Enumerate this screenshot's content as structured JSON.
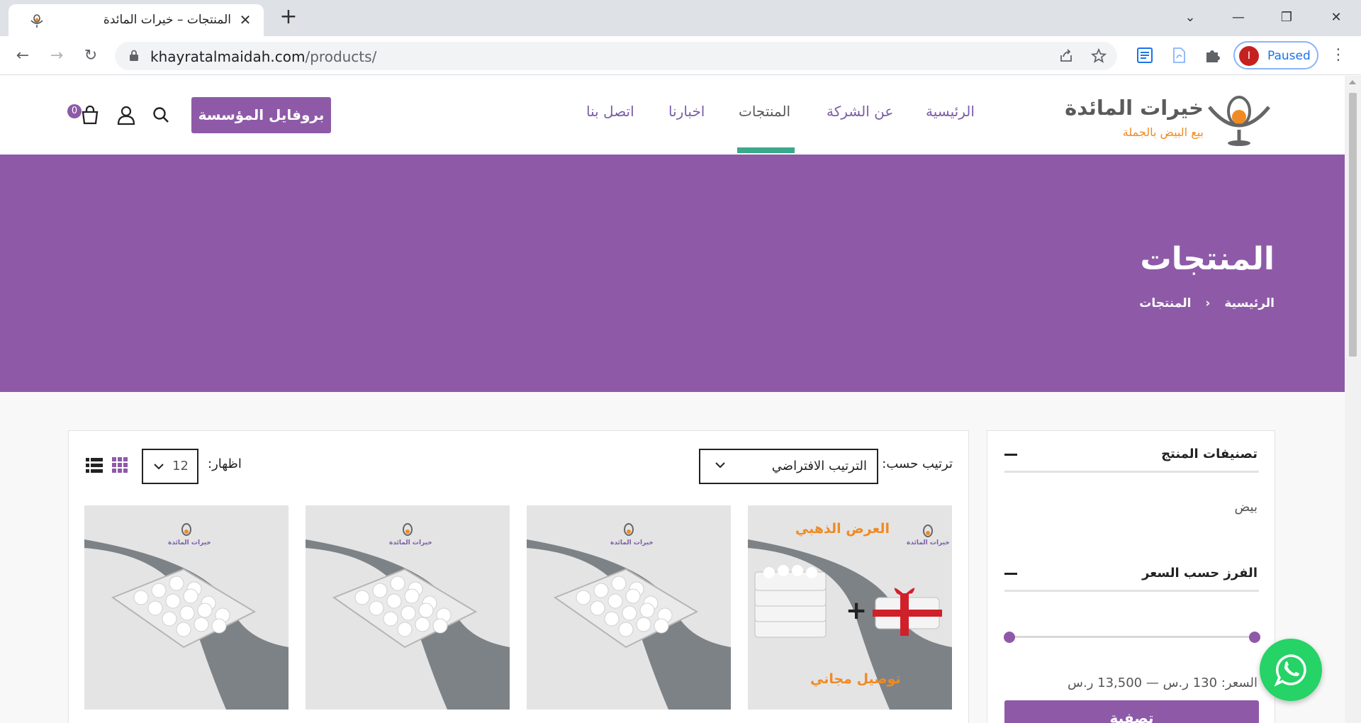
{
  "browser": {
    "tab_title": "المنتجات – خيرات المائدة",
    "url_domain": "khayratalmaidah.com",
    "url_path": "/products/",
    "profile_initial": "I",
    "profile_status": "Paused"
  },
  "header": {
    "logo_name": "خيرات المائدة",
    "logo_tagline": "بيع البيض بالجملة",
    "nav": [
      {
        "label": "الرئيسية"
      },
      {
        "label": "عن الشركة"
      },
      {
        "label": "المنتجات"
      },
      {
        "label": "اخبارنا"
      },
      {
        "label": "اتصل بنا"
      }
    ],
    "active_nav": "المنتجات",
    "profile_button": "بروفايل المؤسسة",
    "cart_count": "0"
  },
  "hero": {
    "title": "المنتجات",
    "breadcrumb_home": "الرئيسية",
    "breadcrumb_current": "المنتجات"
  },
  "sidebar": {
    "categories_title": "تصنيفات المنتج",
    "categories": [
      "بيض"
    ],
    "price_filter_title": "الفرز حسب السعر",
    "price_range_text": "السعر: 130 ر.س — 13,500 ر.س",
    "filter_button": "تصفية"
  },
  "toolbar": {
    "sort_label": "ترتيب حسب:",
    "sort_value": "الترتيب الافتراضي",
    "show_label": "اظهار:",
    "show_value": "12"
  },
  "products": [
    {
      "promo_title": "العرض الذهبي",
      "promo_subtitle": "توصيل مجاني",
      "brand": "خيرات المائدة"
    },
    {
      "brand": "خيرات المائدة"
    },
    {
      "brand": "خيرات المائدة"
    },
    {
      "brand": "خيرات المائدة"
    }
  ],
  "colors": {
    "brand_purple": "#8e5aa8",
    "accent_green": "#3aa88a",
    "accent_orange": "#f08a24",
    "whatsapp_green": "#25d366"
  }
}
